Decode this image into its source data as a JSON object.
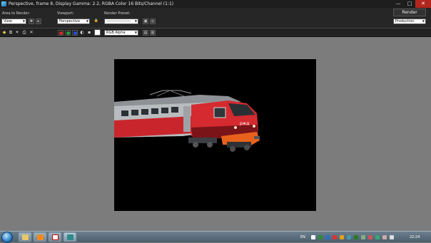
{
  "window": {
    "title": "Perspective, frame 8, Display Gamma: 2.2, RGBA Color 16 Bits/Channel (1:1)",
    "minimize": "—",
    "maximize": "□",
    "close": "✕"
  },
  "panel": {
    "area_label": "Area to Render:",
    "area_value": "View",
    "viewport_label": "Viewport:",
    "viewport_value": "Perspective",
    "preset_label": "Render Preset:",
    "preset_value": "-------------------",
    "render_button": "Render",
    "mode_value": "Production"
  },
  "toolbar2": {
    "channel_value": "RGB Alpha",
    "colors": {
      "red": "#e0261f",
      "green": "#1fa33a",
      "blue": "#2a4fd6"
    }
  },
  "taskbar": {
    "language": "EN",
    "clock": "22:24"
  },
  "icons": [
    "windows-start-icon",
    "explorer-icon",
    "media-player-icon",
    "yandex-icon",
    "3dsmax-icon"
  ]
}
